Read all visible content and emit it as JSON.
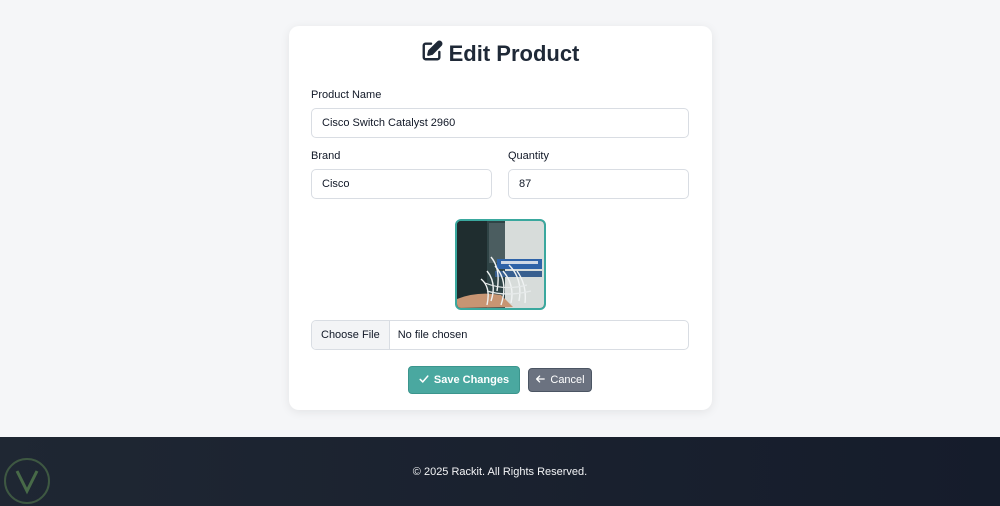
{
  "form": {
    "title": "Edit Product",
    "product_name_label": "Product Name",
    "product_name_value": "Cisco Switch Catalyst 2960",
    "brand_label": "Brand",
    "brand_value": "Cisco",
    "quantity_label": "Quantity",
    "quantity_value": "87",
    "file_button_label": "Choose File",
    "file_status": "No file chosen",
    "save_label": "Save Changes",
    "cancel_label": "Cancel"
  },
  "footer": {
    "copyright": "© 2025 Rackit. All Rights Reserved."
  },
  "colors": {
    "accent": "#4aa8a0",
    "cancel": "#6b7280",
    "footer_bg": "#1f2733"
  },
  "icons": {
    "title_icon": "edit-icon",
    "save_icon": "check-icon",
    "cancel_icon": "arrow-left-icon"
  }
}
